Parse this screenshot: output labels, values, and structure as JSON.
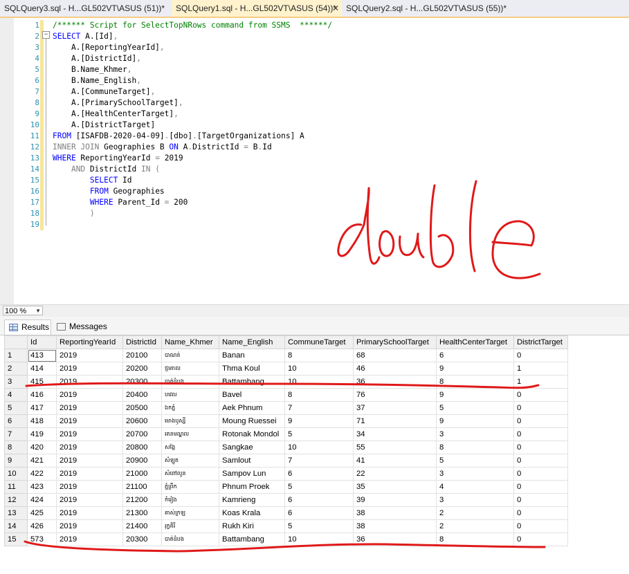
{
  "tabs": [
    {
      "label": "SQLQuery3.sql - H...GL502VT\\ASUS (51))*",
      "active": false
    },
    {
      "label": "SQLQuery1.sql - H...GL502VT\\ASUS (54))*",
      "active": true
    },
    {
      "label": "SQLQuery2.sql - H...GL502VT\\ASUS (55))*",
      "active": false
    }
  ],
  "tab_close_glyph": "✕",
  "editor": {
    "line_numbers": [
      "1",
      "2",
      "3",
      "4",
      "5",
      "6",
      "7",
      "8",
      "9",
      "10",
      "11",
      "12",
      "13",
      "14",
      "15",
      "16",
      "17",
      "18",
      "19"
    ],
    "fold_glyph": "−",
    "lines": [
      [
        {
          "t": "/****** Script for SelectTopNRows command from SSMS  ******/",
          "c": "cm"
        }
      ],
      [
        {
          "t": "SELECT",
          "c": "kw"
        },
        {
          "t": " A.[Id]"
        },
        {
          "t": ",",
          "c": "gy"
        }
      ],
      [
        {
          "t": "    A.[ReportingYearId]"
        },
        {
          "t": ",",
          "c": "gy"
        }
      ],
      [
        {
          "t": "    A.[DistrictId]"
        },
        {
          "t": ",",
          "c": "gy"
        }
      ],
      [
        {
          "t": "    B.Name_Khmer"
        },
        {
          "t": ",",
          "c": "gy"
        }
      ],
      [
        {
          "t": "    B.Name_English"
        },
        {
          "t": ",",
          "c": "gy"
        }
      ],
      [
        {
          "t": "    A.[CommuneTarget]"
        },
        {
          "t": ",",
          "c": "gy"
        }
      ],
      [
        {
          "t": "    A.[PrimarySchoolTarget]"
        },
        {
          "t": ",",
          "c": "gy"
        }
      ],
      [
        {
          "t": "    A.[HealthCenterTarget]"
        },
        {
          "t": ",",
          "c": "gy"
        }
      ],
      [
        {
          "t": "    A.[DistrictTarget]"
        }
      ],
      [
        {
          "t": "FROM",
          "c": "kw"
        },
        {
          "t": " [ISAFDB-2020-04-09]"
        },
        {
          "t": ".",
          "c": "gy"
        },
        {
          "t": "[dbo]"
        },
        {
          "t": ".",
          "c": "gy"
        },
        {
          "t": "[TargetOrganizations] A"
        }
      ],
      [
        {
          "t": "INNER JOIN",
          "c": "gy"
        },
        {
          "t": " Geographies B "
        },
        {
          "t": "ON",
          "c": "kw"
        },
        {
          "t": " A"
        },
        {
          "t": ".",
          "c": "gy"
        },
        {
          "t": "DistrictId "
        },
        {
          "t": "=",
          "c": "gy"
        },
        {
          "t": " B"
        },
        {
          "t": ".",
          "c": "gy"
        },
        {
          "t": "Id"
        }
      ],
      [
        {
          "t": "WHERE",
          "c": "kw"
        },
        {
          "t": " ReportingYearId "
        },
        {
          "t": "=",
          "c": "gy"
        },
        {
          "t": " 2019"
        }
      ],
      [
        {
          "t": "    "
        },
        {
          "t": "AND",
          "c": "gy"
        },
        {
          "t": " DistrictId "
        },
        {
          "t": "IN",
          "c": "gy"
        },
        {
          "t": " "
        },
        {
          "t": "(",
          "c": "gy"
        }
      ],
      [
        {
          "t": "        "
        },
        {
          "t": "SELECT",
          "c": "kw"
        },
        {
          "t": " Id"
        }
      ],
      [
        {
          "t": "        "
        },
        {
          "t": "FROM",
          "c": "kw"
        },
        {
          "t": " Geographies"
        }
      ],
      [
        {
          "t": "        "
        },
        {
          "t": "WHERE",
          "c": "kw"
        },
        {
          "t": " Parent_Id "
        },
        {
          "t": "=",
          "c": "gy"
        },
        {
          "t": " 200"
        }
      ],
      [
        {
          "t": "        "
        },
        {
          "t": ")",
          "c": "gy"
        }
      ],
      [
        {
          "t": ""
        }
      ]
    ]
  },
  "zoom": {
    "value": "100 %"
  },
  "results_tabs": [
    {
      "label": "Results",
      "icon": "grid-icon",
      "active": true
    },
    {
      "label": "Messages",
      "icon": "messages-icon",
      "active": false
    }
  ],
  "results": {
    "columns": [
      "",
      "Id",
      "ReportingYearId",
      "DistrictId",
      "Name_Khmer",
      "Name_English",
      "CommuneTarget",
      "PrimarySchoolTarget",
      "HealthCenterTarget",
      "DistrictTarget"
    ],
    "rows": [
      [
        "1",
        "413",
        "2019",
        "20100",
        "បាណន់",
        "Banan",
        "8",
        "68",
        "6",
        "0"
      ],
      [
        "2",
        "414",
        "2019",
        "20200",
        "ថ្មគោល",
        "Thma Koul",
        "10",
        "46",
        "9",
        "1"
      ],
      [
        "3",
        "415",
        "2019",
        "20300",
        "បាត់ដំបង",
        "Battambang",
        "10",
        "36",
        "8",
        "1"
      ],
      [
        "4",
        "416",
        "2019",
        "20400",
        "បវេល",
        "Bavel",
        "8",
        "76",
        "9",
        "0"
      ],
      [
        "5",
        "417",
        "2019",
        "20500",
        "ឯកភ្នំ",
        "Aek Phnum",
        "7",
        "37",
        "5",
        "0"
      ],
      [
        "6",
        "418",
        "2019",
        "20600",
        "មោងឫស្សី",
        "Moung Ruessei",
        "9",
        "71",
        "9",
        "0"
      ],
      [
        "7",
        "419",
        "2019",
        "20700",
        "រតនមណ្ឌល",
        "Rotonak Mondol",
        "5",
        "34",
        "3",
        "0"
      ],
      [
        "8",
        "420",
        "2019",
        "20800",
        "សង្កែ",
        "Sangkae",
        "10",
        "55",
        "8",
        "0"
      ],
      [
        "9",
        "421",
        "2019",
        "20900",
        "សំឡូត",
        "Samlout",
        "7",
        "41",
        "5",
        "0"
      ],
      [
        "10",
        "422",
        "2019",
        "21000",
        "សំពៅលូន",
        "Sampov Lun",
        "6",
        "22",
        "3",
        "0"
      ],
      [
        "11",
        "423",
        "2019",
        "21100",
        "ភ្នំព្រឹក",
        "Phnum Proek",
        "5",
        "35",
        "4",
        "0"
      ],
      [
        "12",
        "424",
        "2019",
        "21200",
        "កំរៀង",
        "Kamrieng",
        "6",
        "39",
        "3",
        "0"
      ],
      [
        "13",
        "425",
        "2019",
        "21300",
        "គាស់ក្រឡ",
        "Koas Krala",
        "6",
        "38",
        "2",
        "0"
      ],
      [
        "14",
        "426",
        "2019",
        "21400",
        "រុក្ខគិរី",
        "Rukh Kiri",
        "5",
        "38",
        "2",
        "0"
      ],
      [
        "15",
        "573",
        "2019",
        "20300",
        "បាត់ដំបង",
        "Battambang",
        "10",
        "36",
        "8",
        "0"
      ]
    ]
  }
}
